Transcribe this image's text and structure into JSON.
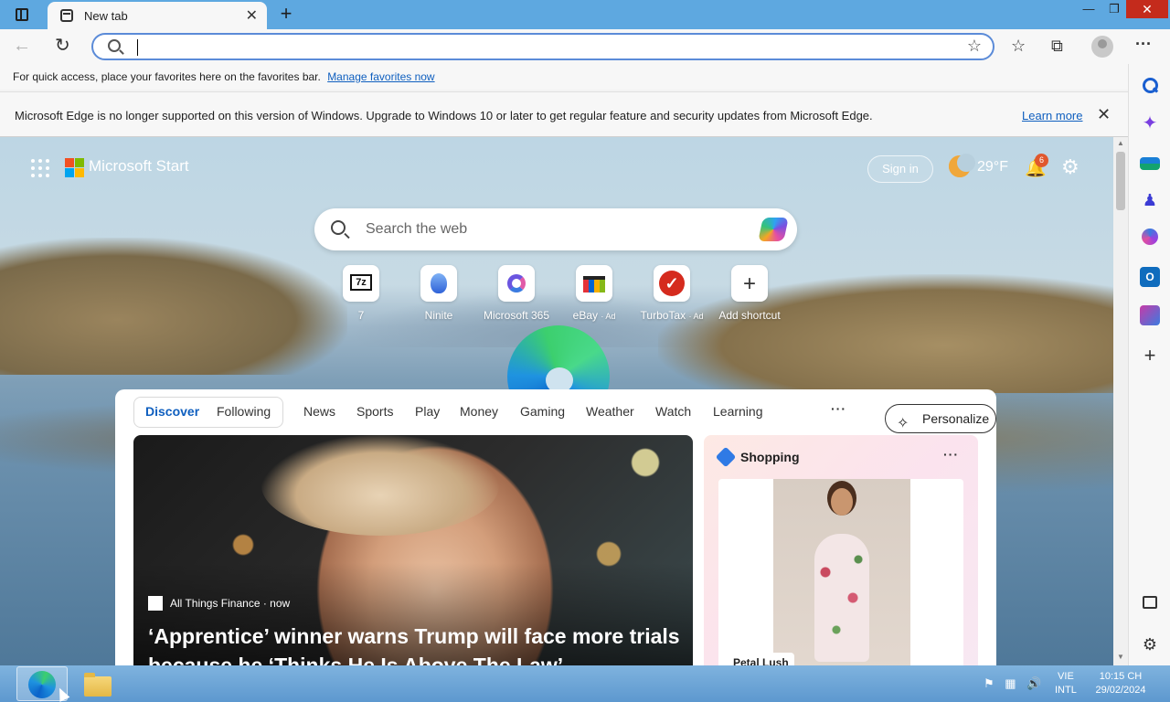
{
  "browser": {
    "tab_title": "New tab",
    "tab_close": "✕",
    "new_tab": "+",
    "window_controls": {
      "minimize": "—",
      "maximize": "❐",
      "close": "✕"
    },
    "address_value": "",
    "fav_bar_text": "For quick access, place your favorites here on the favorites bar.",
    "fav_bar_link": "Manage favorites now",
    "infobar_text": "Microsoft Edge is no longer supported on this version of Windows. Upgrade to Windows 10 or later to get regular feature and security updates from Microsoft Edge.",
    "infobar_link": "Learn more",
    "infobar_close": "✕",
    "icons": {
      "back": "←",
      "refresh": "↻",
      "add_favorite": "☆",
      "favorites": "☆",
      "collections": "⧉",
      "menu": "···"
    }
  },
  "sidebar": {
    "items": [
      "search-icon",
      "copilot-icon",
      "shopping-icon",
      "games-icon",
      "microsoft365-icon",
      "outlook-icon",
      "designer-icon",
      "add-icon",
      "hide-sidebar-icon",
      "settings-icon"
    ],
    "copilot_glyph": "✦",
    "games_glyph": "♟",
    "outlook_glyph": "O",
    "add_glyph": "+",
    "settings_glyph": "⚙"
  },
  "start": {
    "brand": "Microsoft Start",
    "logo_colors": [
      "#f25022",
      "#7fba00",
      "#00a4ef",
      "#ffb900"
    ],
    "sign_in": "Sign in",
    "temperature": "29°F",
    "notification_count": "6",
    "bell_glyph": "🔔",
    "gear_glyph": "⚙",
    "search_placeholder": "Search the web",
    "shortcuts": [
      {
        "label": "7",
        "ad": ""
      },
      {
        "label": "Ninite",
        "ad": ""
      },
      {
        "label": "Microsoft 365",
        "ad": ""
      },
      {
        "label": "eBay",
        "ad": "· Ad"
      },
      {
        "label": "TurboTax",
        "ad": "· Ad"
      },
      {
        "label": "Add shortcut",
        "ad": ""
      }
    ],
    "shortcut_glyphs": {
      "seven_zip": "7z",
      "turbotax": "✓",
      "add": "+"
    }
  },
  "feed": {
    "tabs": [
      "Discover",
      "Following",
      "News",
      "Sports",
      "Play",
      "Money",
      "Gaming",
      "Weather",
      "Watch",
      "Learning"
    ],
    "more": "···",
    "personalize": "Personalize",
    "personalize_glyph": "✧",
    "hero": {
      "source": "All Things Finance · now",
      "title": "‘Apprentice’ winner warns Trump will face more trials because he ‘Thinks He Is Above The Law’"
    },
    "shopping": {
      "title": "Shopping",
      "more": "···",
      "brand": "Petal Lush"
    }
  },
  "taskbar": {
    "tray_icons": [
      "⚑",
      "▦",
      "🔊"
    ],
    "lang_line1": "VIE",
    "lang_line2": "INTL",
    "time": "10:15 CH",
    "date": "29/02/2024"
  }
}
